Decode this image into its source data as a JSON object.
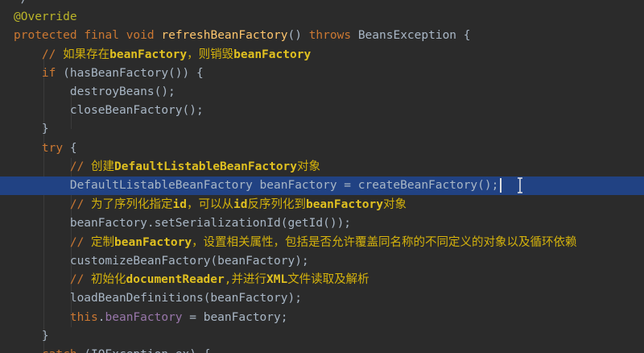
{
  "editor": {
    "lines": [
      {
        "id": "l0",
        "tokens": [
          {
            "t": "*/",
            "c": "plain"
          }
        ]
      },
      {
        "id": "l1",
        "tokens": [
          {
            "t": "@Override",
            "c": "ann"
          }
        ]
      },
      {
        "id": "l2",
        "tokens": [
          {
            "t": "protected ",
            "c": "kw"
          },
          {
            "t": "final ",
            "c": "kw"
          },
          {
            "t": "void ",
            "c": "kw"
          },
          {
            "t": "refreshBeanFactory",
            "c": "fn"
          },
          {
            "t": "() ",
            "c": "plain"
          },
          {
            "t": "throws ",
            "c": "kw"
          },
          {
            "t": "BeansException {",
            "c": "plain"
          }
        ]
      },
      {
        "id": "l3",
        "tokens": [
          {
            "t": "    // ",
            "c": "comment-slash"
          },
          {
            "t": "如果存在",
            "c": "comment"
          },
          {
            "t": "beanFactory",
            "c": "comment-bold"
          },
          {
            "t": "，则销毁",
            "c": "comment"
          },
          {
            "t": "beanFactory",
            "c": "comment-bold"
          }
        ]
      },
      {
        "id": "l4",
        "tokens": [
          {
            "t": "    if ",
            "c": "kw"
          },
          {
            "t": "(hasBeanFactory()) {",
            "c": "plain"
          }
        ]
      },
      {
        "id": "l5",
        "tokens": [
          {
            "t": "        destroyBeans();",
            "c": "plain"
          }
        ]
      },
      {
        "id": "l6",
        "tokens": [
          {
            "t": "        closeBeanFactory();",
            "c": "plain"
          }
        ]
      },
      {
        "id": "l7",
        "tokens": [
          {
            "t": "    }",
            "c": "plain"
          }
        ]
      },
      {
        "id": "l8",
        "tokens": [
          {
            "t": "    try ",
            "c": "kw"
          },
          {
            "t": "{",
            "c": "plain"
          }
        ]
      },
      {
        "id": "l9",
        "tokens": [
          {
            "t": "        // ",
            "c": "comment-slash"
          },
          {
            "t": "创建",
            "c": "comment"
          },
          {
            "t": "DefaultListableBeanFactory",
            "c": "comment-bold"
          },
          {
            "t": "对象",
            "c": "comment"
          }
        ]
      },
      {
        "id": "l10",
        "current": true,
        "tokens": [
          {
            "t": "        DefaultListableBeanFactory beanFactory = createBeanFactory();",
            "c": "plain"
          }
        ]
      },
      {
        "id": "l11",
        "tokens": [
          {
            "t": "        // ",
            "c": "comment-slash"
          },
          {
            "t": "为了序列化指定",
            "c": "comment"
          },
          {
            "t": "id",
            "c": "comment-bold"
          },
          {
            "t": "，可以从",
            "c": "comment"
          },
          {
            "t": "id",
            "c": "comment-bold"
          },
          {
            "t": "反序列化到",
            "c": "comment"
          },
          {
            "t": "beanFactory",
            "c": "comment-bold"
          },
          {
            "t": "对象",
            "c": "comment"
          }
        ]
      },
      {
        "id": "l12",
        "tokens": [
          {
            "t": "        beanFactory.setSerializationId(getId());",
            "c": "plain"
          }
        ]
      },
      {
        "id": "l13",
        "tokens": [
          {
            "t": "        // ",
            "c": "comment-slash"
          },
          {
            "t": "定制",
            "c": "comment"
          },
          {
            "t": "beanFactory",
            "c": "comment-bold"
          },
          {
            "t": "，设置相关属性，包括是否允许覆盖同名称的不同定义的对象以及循环依赖",
            "c": "comment"
          }
        ]
      },
      {
        "id": "l14",
        "tokens": [
          {
            "t": "        customizeBeanFactory(beanFactory);",
            "c": "plain"
          }
        ]
      },
      {
        "id": "l15",
        "tokens": [
          {
            "t": "        // ",
            "c": "comment-slash"
          },
          {
            "t": "初始化",
            "c": "comment"
          },
          {
            "t": "documentReader",
            "c": "comment-bold"
          },
          {
            "t": ",并进行",
            "c": "comment"
          },
          {
            "t": "XML",
            "c": "comment-bold"
          },
          {
            "t": "文件读取及解析",
            "c": "comment"
          }
        ]
      },
      {
        "id": "l16",
        "tokens": [
          {
            "t": "        loadBeanDefinitions(beanFactory);",
            "c": "plain"
          }
        ]
      },
      {
        "id": "l17",
        "tokens": [
          {
            "t": "        this",
            "c": "kw"
          },
          {
            "t": ".",
            "c": "plain"
          },
          {
            "t": "beanFactory",
            "c": "field"
          },
          {
            "t": " = beanFactory;",
            "c": "plain"
          }
        ]
      },
      {
        "id": "l18",
        "tokens": [
          {
            "t": "    }",
            "c": "plain"
          }
        ]
      },
      {
        "id": "l19",
        "tokens": [
          {
            "t": "    catch ",
            "c": "kw"
          },
          {
            "t": "(IOException ex) {",
            "c": "plain"
          }
        ]
      }
    ]
  }
}
